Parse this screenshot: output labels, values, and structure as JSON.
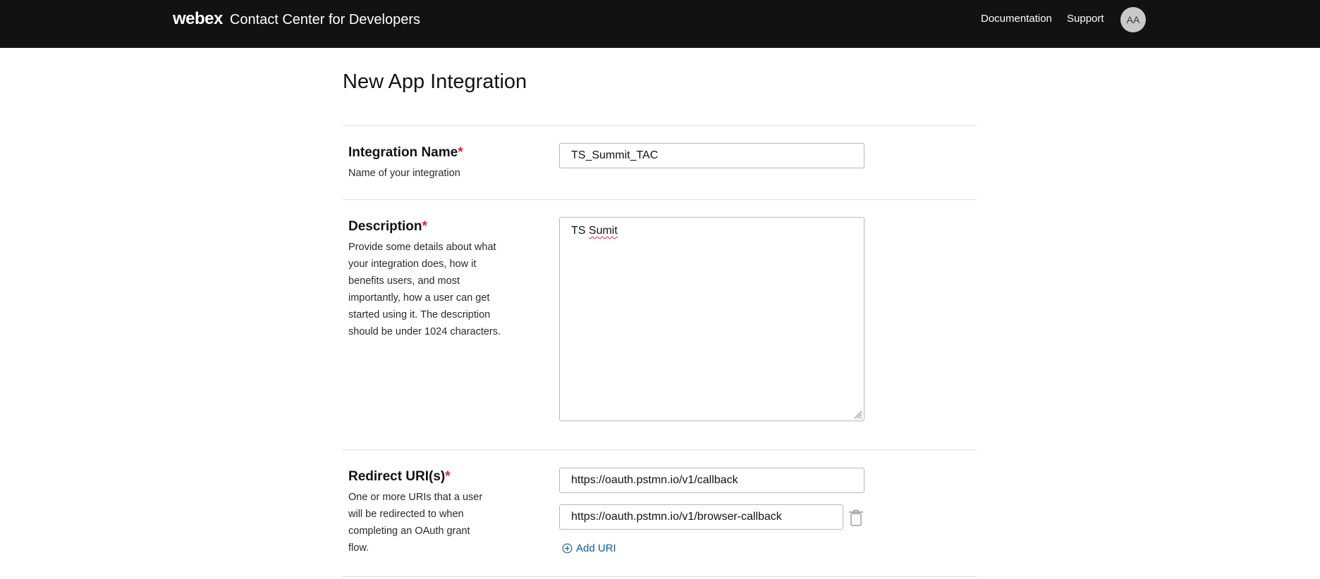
{
  "header": {
    "brand_logo": "webex",
    "brand_subtitle": "Contact Center for Developers",
    "nav": {
      "documentation": "Documentation",
      "support": "Support"
    },
    "avatar_initials": "AA"
  },
  "page": {
    "title": "New App Integration"
  },
  "form": {
    "integration_name": {
      "label": "Integration Name",
      "required_mark": "*",
      "help": "Name of your integration",
      "value": "TS_Summit_TAC"
    },
    "description": {
      "label": "Description",
      "required_mark": "*",
      "help": "Provide some details about what your integration does, how it benefits users, and most importantly, how a user can get started using it. The description should be under 1024 characters.",
      "value_word1": "TS",
      "value_word2": "Sumit"
    },
    "redirect_uris": {
      "label": "Redirect URI(s)",
      "required_mark": "*",
      "help": "One or more URIs that a user will be redirected to when completing an OAuth grant flow.",
      "uris": [
        "https://oauth.pstmn.io/v1/callback",
        "https://oauth.pstmn.io/v1/browser-callback"
      ],
      "add_label": "Add URI"
    }
  },
  "colors": {
    "topbar": "#121212",
    "required": "#d6262f",
    "link": "#0a5d96"
  }
}
